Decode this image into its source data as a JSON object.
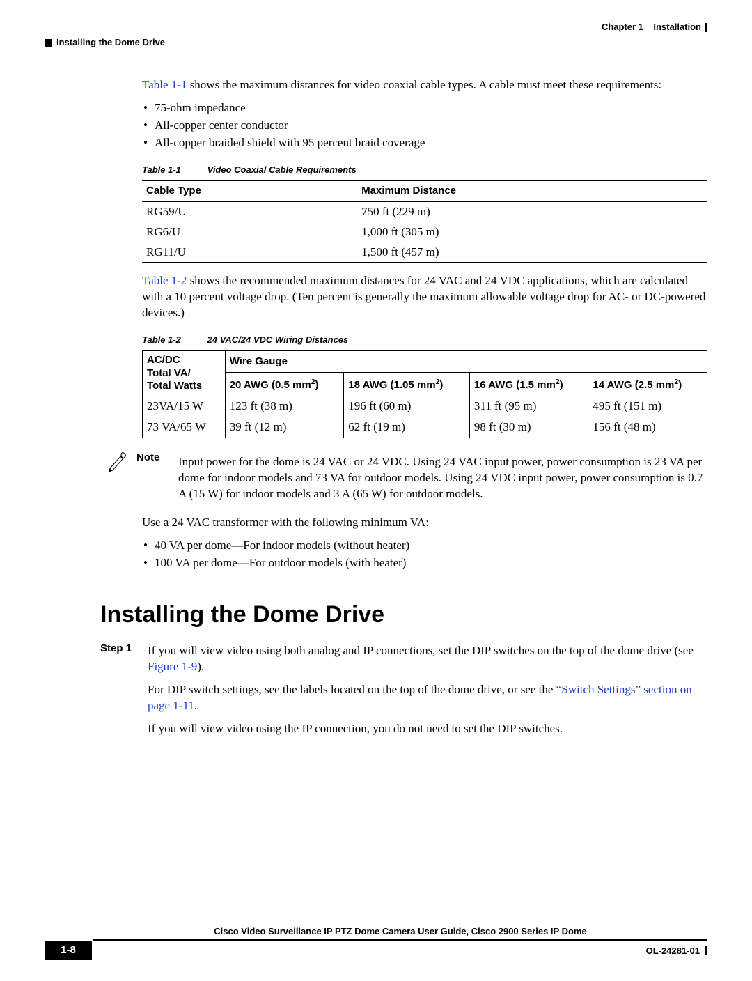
{
  "header": {
    "chapter_label": "Chapter 1",
    "chapter_title": "Installation",
    "section_title": "Installing the Dome Drive"
  },
  "intro_para": {
    "link": "Table 1-1",
    "rest": " shows the maximum distances for video coaxial cable types. A cable must meet these requirements:"
  },
  "req_bullets": [
    "75-ohm impedance",
    "All-copper center conductor",
    "All-copper braided shield with 95 percent braid coverage"
  ],
  "table1": {
    "number": "Table 1-1",
    "caption": "Video Coaxial Cable Requirements",
    "headers": [
      "Cable Type",
      "Maximum Distance"
    ],
    "rows": [
      [
        "RG59/U",
        "750 ft (229 m)"
      ],
      [
        "RG6/U",
        "1,000 ft (305 m)"
      ],
      [
        "RG11/U",
        "1,500 ft (457 m)"
      ]
    ]
  },
  "mid_para": {
    "link": "Table 1-2",
    "rest": " shows the recommended maximum distances for 24 VAC and 24 VDC applications, which are calculated with a 10 percent voltage drop. (Ten percent is generally the maximum allowable voltage drop for AC- or DC-powered devices.)"
  },
  "table2": {
    "number": "Table 1-2",
    "caption": "24 VAC/24 VDC Wiring Distances",
    "left_header_lines": [
      "AC/DC",
      "Total VA/",
      "Total Watts"
    ],
    "top_header": "Wire Gauge",
    "col_headers": [
      {
        "pre": "20 AWG (0.5 mm",
        "sup": "2",
        "post": ")"
      },
      {
        "pre": "18 AWG (1.05 mm",
        "sup": "2",
        "post": ")"
      },
      {
        "pre": "16 AWG (1.5 mm",
        "sup": "2",
        "post": ")"
      },
      {
        "pre": "14 AWG (2.5 mm",
        "sup": "2",
        "post": ")"
      }
    ],
    "rows": [
      [
        "23VA/15 W",
        "123 ft (38 m)",
        "196 ft (60 m)",
        "311 ft (95 m)",
        "495 ft (151 m)"
      ],
      [
        "73 VA/65 W",
        "39 ft (12 m)",
        "62 ft (19 m)",
        "98 ft (30 m)",
        "156 ft (48 m)"
      ]
    ]
  },
  "note": {
    "label": "Note",
    "text": "Input power for the dome is 24 VAC or 24 VDC. Using 24 VAC input power, power consumption is 23 VA per dome for indoor models and 73 VA for outdoor models. Using 24 VDC input power, power consumption is 0.7 A (15 W) for indoor models and 3 A (65 W) for outdoor models."
  },
  "transformer_para": "Use a 24 VAC transformer with the following minimum VA:",
  "transformer_bullets": [
    "40 VA per dome—For indoor models (without heater)",
    "100 VA per dome—For outdoor models (with heater)"
  ],
  "heading": "Installing the Dome Drive",
  "step1": {
    "label": "Step 1",
    "p1_a": "If you will view video using both analog and IP connections, set the DIP switches on the top of the dome drive (see ",
    "p1_link": "Figure 1-9",
    "p1_b": ").",
    "p2_a": "For DIP switch settings, see the labels located on the top of the dome drive, or see the ",
    "p2_link": "“Switch Settings” section on page 1-11",
    "p2_b": ".",
    "p3": "If you will view video using the IP connection, you do not need to set the DIP switches."
  },
  "footer": {
    "book_title": "Cisco Video Surveillance IP PTZ Dome Camera User Guide, Cisco 2900 Series IP Dome",
    "page_number": "1-8",
    "doc_id": "OL-24281-01"
  }
}
